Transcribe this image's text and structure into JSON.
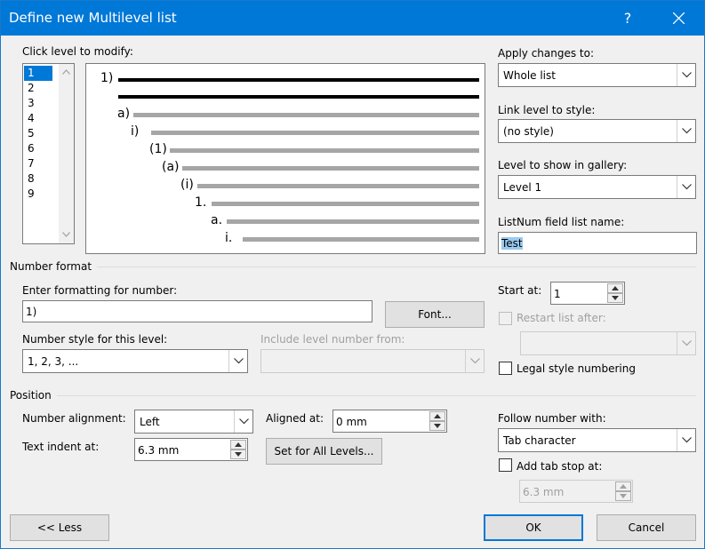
{
  "window": {
    "title": "Define new Multilevel list",
    "help_label": "?"
  },
  "levels": {
    "label": "Click level to modify:",
    "items": [
      "1",
      "2",
      "3",
      "4",
      "5",
      "6",
      "7",
      "8",
      "9"
    ],
    "selected": "1"
  },
  "preview": {
    "numbers": [
      "1)",
      "a)",
      "i)",
      "(1)",
      "(a)",
      "(i)",
      "1.",
      "a.",
      "i."
    ]
  },
  "apply_changes": {
    "label": "Apply changes to:",
    "value": "Whole list"
  },
  "link_level": {
    "label": "Link level to style:",
    "value": "(no style)"
  },
  "gallery_level": {
    "label": "Level to show in gallery:",
    "value": "Level 1"
  },
  "listnum": {
    "label": "ListNum field list name:",
    "value": "Test"
  },
  "number_format": {
    "section_label": "Number format",
    "enter_label": "Enter formatting for number:",
    "format_value": "1)",
    "font_button": "Font...",
    "style_label": "Number style for this level:",
    "style_value": "1, 2, 3, ...",
    "include_label": "Include level number from:",
    "include_value": "",
    "start_label": "Start at:",
    "start_value": "1",
    "restart_label": "Restart list after:",
    "restart_value": "",
    "legal_label": "Legal style numbering"
  },
  "position": {
    "section_label": "Position",
    "alignment_label": "Number alignment:",
    "alignment_value": "Left",
    "aligned_at_label": "Aligned at:",
    "aligned_at_value": "0 mm",
    "indent_label": "Text indent at:",
    "indent_value": "6.3 mm",
    "set_all_button": "Set for All Levels...",
    "follow_label": "Follow number with:",
    "follow_value": "Tab character",
    "tab_stop_label": "Add tab stop at:",
    "tab_stop_value": "6.3 mm"
  },
  "footer": {
    "less_button": "<< Less",
    "ok_button": "OK",
    "cancel_button": "Cancel"
  },
  "colors": {
    "titlebar": "#0078d7",
    "selection": "#0078d7",
    "dialog_background": "#f0f0f0"
  }
}
